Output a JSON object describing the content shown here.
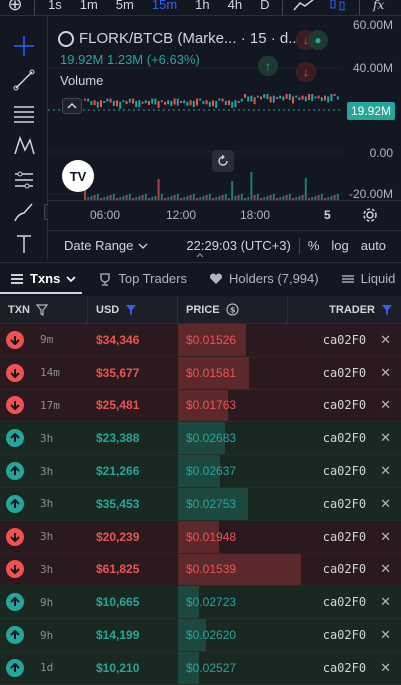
{
  "toolbar": {
    "timeframes": [
      "1s",
      "1m",
      "5m",
      "15m",
      "1h",
      "4h",
      "D"
    ],
    "active_timeframe": "15m"
  },
  "chart": {
    "symbol_title": "FLORK/BTCB (Marke... · 15 · d...",
    "volume_value": "19.92M",
    "volume_change": "1.23M (+6.63%)",
    "volume_label": "Volume",
    "price_label": "19.92M",
    "y_ticks": [
      "60.00M",
      "40.00M",
      "20.00M",
      "0.00",
      "-20.00M"
    ],
    "x_ticks": [
      "06:00",
      "12:00",
      "18:00"
    ],
    "x_end": "5",
    "brand": "TV"
  },
  "bottombar": {
    "date_range": "Date Range",
    "clock": "22:29:03 (UTC+3)",
    "percent": "%",
    "log": "log",
    "auto": "auto"
  },
  "tabs": [
    {
      "label": "Txns",
      "active": true
    },
    {
      "label": "Top Traders",
      "active": false
    },
    {
      "label": "Holders (7,994)",
      "active": false
    },
    {
      "label": "Liquid",
      "active": false
    }
  ],
  "table": {
    "headers": {
      "txn": "TXN",
      "usd": "USD",
      "price": "PRICE",
      "trader": "TRADER"
    },
    "rows": [
      {
        "dir": "sell",
        "age": "9m",
        "usd": "$34,346",
        "price": "$0.01526",
        "trader": "ca02F0",
        "fill": 0.55
      },
      {
        "dir": "sell",
        "age": "14m",
        "usd": "$35,677",
        "price": "$0.01581",
        "trader": "ca02F0",
        "fill": 0.58
      },
      {
        "dir": "sell",
        "age": "17m",
        "usd": "$25,481",
        "price": "$0.01763",
        "trader": "ca02F0",
        "fill": 0.41
      },
      {
        "dir": "buy",
        "age": "3h",
        "usd": "$23,388",
        "price": "$0.02683",
        "trader": "ca02F0",
        "fill": 0.38
      },
      {
        "dir": "buy",
        "age": "3h",
        "usd": "$21,266",
        "price": "$0.02637",
        "trader": "ca02F0",
        "fill": 0.34
      },
      {
        "dir": "buy",
        "age": "3h",
        "usd": "$35,453",
        "price": "$0.02753",
        "trader": "ca02F0",
        "fill": 0.57
      },
      {
        "dir": "sell",
        "age": "3h",
        "usd": "$20,239",
        "price": "$0.01948",
        "trader": "ca02F0",
        "fill": 0.33
      },
      {
        "dir": "sell",
        "age": "3h",
        "usd": "$61,825",
        "price": "$0.01539",
        "trader": "ca02F0",
        "fill": 1.0
      },
      {
        "dir": "buy",
        "age": "9h",
        "usd": "$10,665",
        "price": "$0.02723",
        "trader": "ca02F0",
        "fill": 0.17
      },
      {
        "dir": "buy",
        "age": "9h",
        "usd": "$14,199",
        "price": "$0.02620",
        "trader": "ca02F0",
        "fill": 0.23
      },
      {
        "dir": "buy",
        "age": "1d",
        "usd": "$10,210",
        "price": "$0.02527",
        "trader": "ca02F0",
        "fill": 0.17
      }
    ]
  },
  "colors": {
    "buy": "#26a69a",
    "sell": "#ef5350",
    "accent": "#2962ff"
  }
}
